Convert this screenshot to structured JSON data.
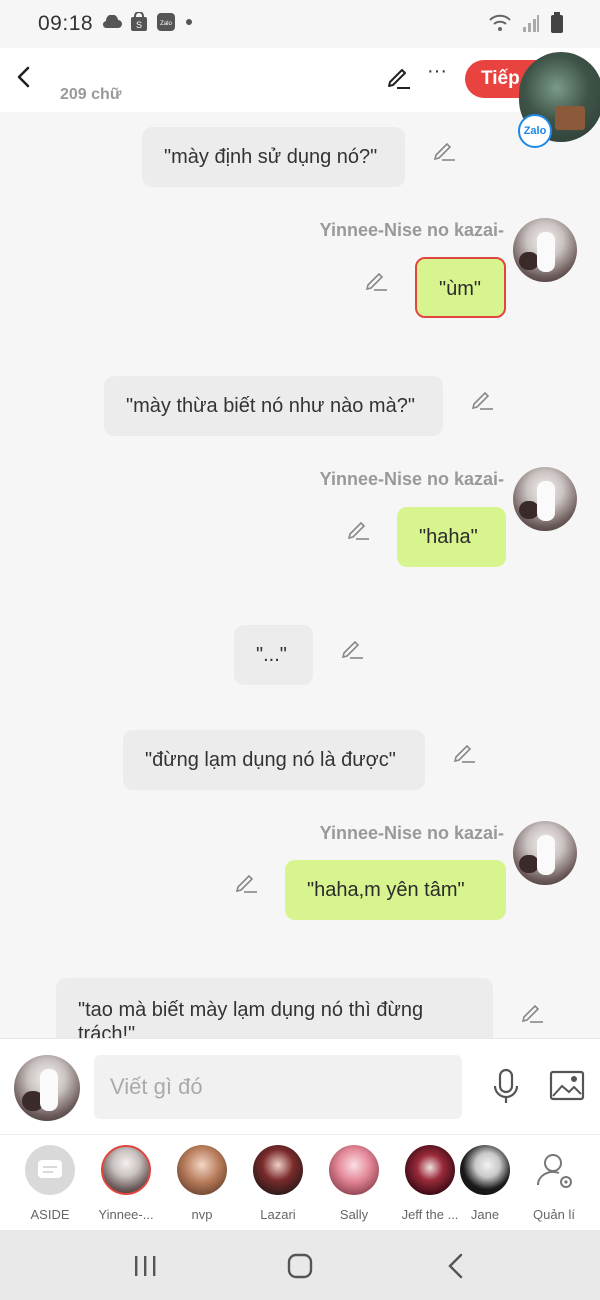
{
  "status_bar": {
    "time": "09:18",
    "left_icons": [
      "cloud-icon",
      "shopee-icon",
      "zalo-icon",
      "dot-icon"
    ],
    "right_icons": [
      "wifi-icon",
      "signal-icon",
      "battery-icon"
    ]
  },
  "header": {
    "word_count": "209 chữ",
    "next_label": "Tiếp",
    "floating_badge": "Zalo"
  },
  "messages": [
    {
      "side": "other",
      "text": "\"mày định sử dụng nó?\""
    },
    {
      "side": "self",
      "sender": "Yinnee-Nise no kazai-",
      "text": "\"ùm\"",
      "selected": true
    },
    {
      "side": "other",
      "text": "\"mày thừa biết nó như nào mà?\""
    },
    {
      "side": "self",
      "sender": "Yinnee-Nise no kazai-",
      "text": "\"haha\""
    },
    {
      "side": "other",
      "text": "\"...\""
    },
    {
      "side": "other",
      "text": "\"đừng lạm dụng nó là được\""
    },
    {
      "side": "self",
      "sender": "Yinnee-Nise no kazai-",
      "text": "\"haha,m yên tâm\""
    },
    {
      "side": "other",
      "text": "\"tao mà biết mày lạm dụng nó thì đừng trách!\""
    }
  ],
  "composer": {
    "placeholder": "Viết gì đó"
  },
  "characters": [
    {
      "name": "ASIDE"
    },
    {
      "name": "Yinnee-...",
      "selected": true
    },
    {
      "name": "nvp"
    },
    {
      "name": "Lazari"
    },
    {
      "name": "Sally"
    },
    {
      "name": "Jeff the ..."
    },
    {
      "name": "Jane"
    },
    {
      "name": "Quản lí"
    }
  ],
  "colors": {
    "accent": "#e8433f",
    "self_bubble": "#d7f48e",
    "other_bubble": "#ececec",
    "background": "#f6f6f6"
  }
}
